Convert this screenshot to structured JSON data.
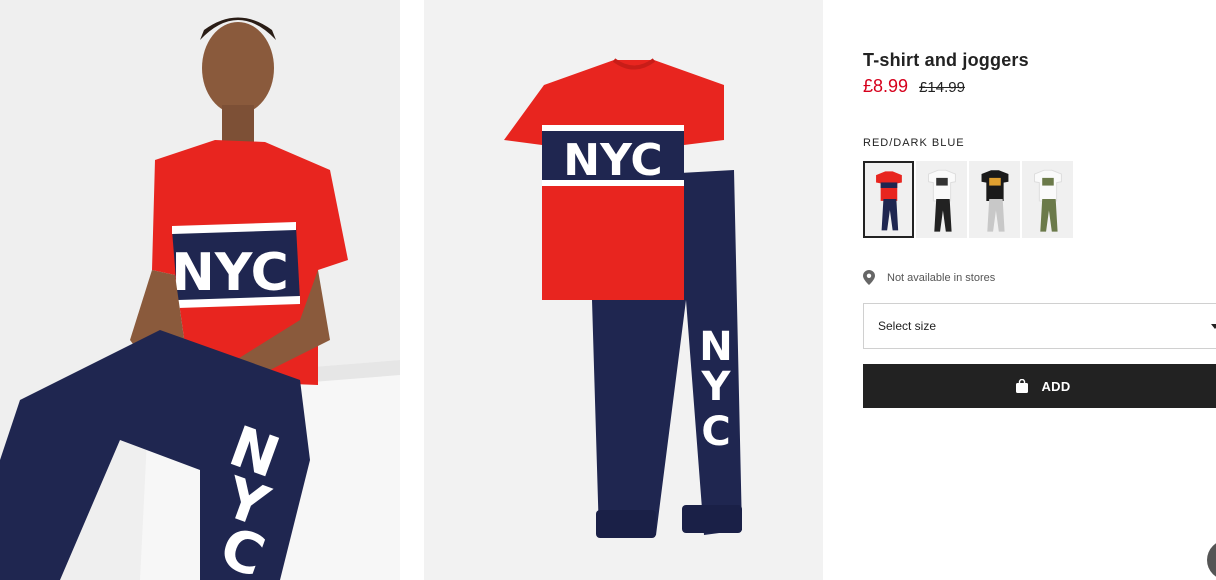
{
  "product": {
    "title": "T-shirt and joggers",
    "price_current": "£8.99",
    "price_original": "£14.99",
    "color_name": "RED/DARK BLUE",
    "graphic_text": "NYC"
  },
  "swatches": [
    {
      "name": "red-dark-blue",
      "selected": true
    },
    {
      "name": "white-black",
      "selected": false
    },
    {
      "name": "black-grey",
      "selected": false
    },
    {
      "name": "white-khaki",
      "selected": false
    }
  ],
  "availability": {
    "icon": "location-pin-icon",
    "text": "Not available in stores"
  },
  "size_select": {
    "label": "Select size",
    "icon": "chevron-down-icon"
  },
  "add_button": {
    "label": "ADD",
    "icon": "shopping-bag-icon"
  },
  "colors": {
    "sale_price": "#d6001c",
    "button_bg": "#222222",
    "shirt_red": "#e8251f",
    "pants_navy": "#1f2650"
  }
}
